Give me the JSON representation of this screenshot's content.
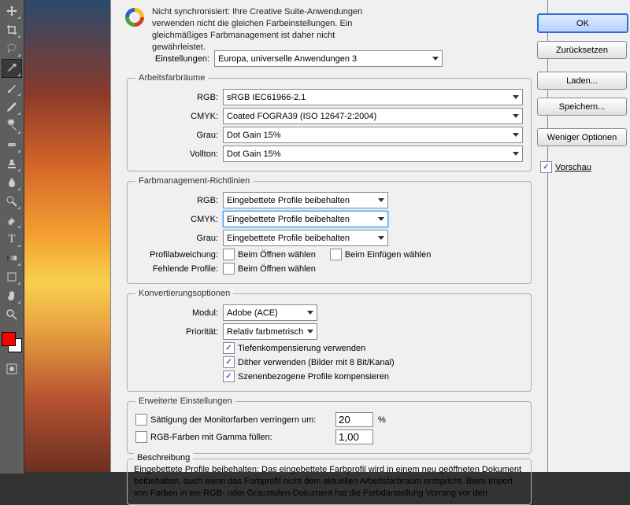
{
  "sync_message": "Nicht synchronisiert: Ihre Creative Suite-Anwendungen verwenden nicht die gleichen Farbeinstellungen. Ein gleichmäßiges Farbmanagement ist daher nicht gewährleistet.",
  "settings": {
    "label": "Einstellungen:",
    "value": "Europa, universelle Anwendungen 3"
  },
  "workspaces": {
    "legend": "Arbeitsfarbräume",
    "rgb": {
      "label": "RGB:",
      "value": "sRGB IEC61966-2.1"
    },
    "cmyk": {
      "label": "CMYK:",
      "value": "Coated FOGRA39 (ISO 12647-2:2004)"
    },
    "gray": {
      "label": "Grau:",
      "value": "Dot Gain 15%"
    },
    "spot": {
      "label": "Vollton:",
      "value": "Dot Gain 15%"
    }
  },
  "policies": {
    "legend": "Farbmanagement-Richtlinien",
    "rgb": {
      "label": "RGB:",
      "value": "Eingebettete Profile beibehalten"
    },
    "cmyk": {
      "label": "CMYK:",
      "value": "Eingebettete Profile beibehalten"
    },
    "gray": {
      "label": "Grau:",
      "value": "Eingebettete Profile beibehalten"
    },
    "mismatch": {
      "label": "Profilabweichung:",
      "open": "Beim Öffnen wählen",
      "paste": "Beim Einfügen wählen"
    },
    "missing": {
      "label": "Fehlende Profile:",
      "open": "Beim Öffnen wählen"
    }
  },
  "conversion": {
    "legend": "Konvertierungsoptionen",
    "engine": {
      "label": "Modul:",
      "value": "Adobe (ACE)"
    },
    "intent": {
      "label": "Priorität:",
      "value": "Relativ farbmetrisch"
    },
    "blackpoint": "Tiefenkompensierung verwenden",
    "dither": "Dither verwenden (Bilder mit 8 Bit/Kanal)",
    "scene": "Szenenbezogene Profile kompensieren"
  },
  "advanced": {
    "legend": "Erweiterte Einstellungen",
    "desat": {
      "label": "Sättigung der Monitorfarben verringern um:",
      "value": "20",
      "pct": "%"
    },
    "gamma": {
      "label": "RGB-Farben mit Gamma füllen:",
      "value": "1,00"
    }
  },
  "description": {
    "legend": "Beschreibung",
    "text": "Eingebettete Profile beibehalten: Das eingebettete Farbprofil wird in einem neu geöffneten Dokument beibehalten, auch wenn das Farbprofil nicht dem aktuellen Arbeitsfarbraum entspricht. Beim Import von Farben in ein RGB- oder Graustufen-Dokument hat die Farbdarstellung Vorrang vor den"
  },
  "buttons": {
    "ok": "OK",
    "cancel": "Zurücksetzen",
    "load": "Laden...",
    "save": "Speichern...",
    "fewer": "Weniger Optionen"
  },
  "preview": {
    "label": "Vorschau"
  }
}
